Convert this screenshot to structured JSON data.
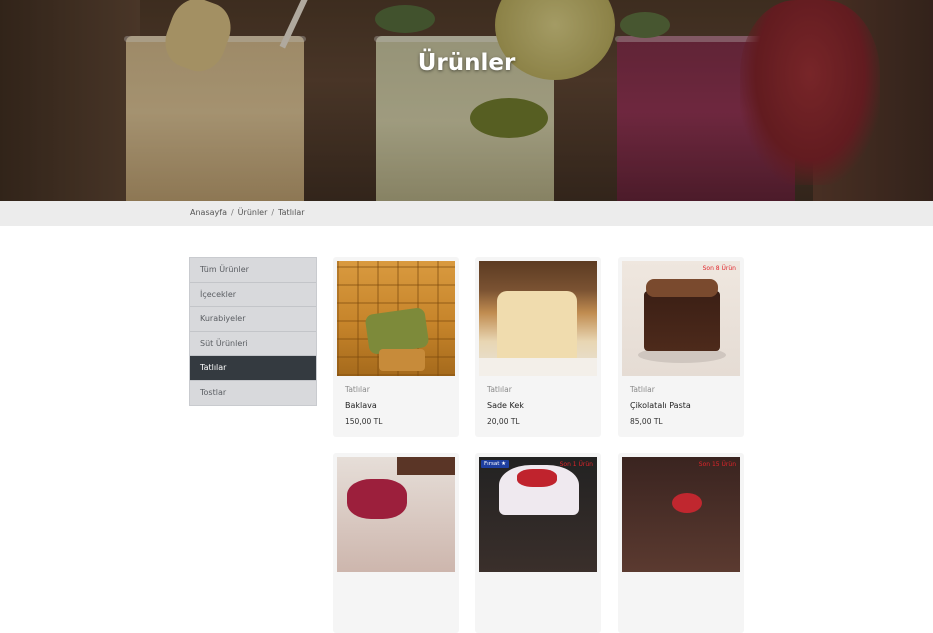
{
  "hero": {
    "title": "Ürünler"
  },
  "breadcrumb": {
    "items": [
      "Anasayfa",
      "Ürünler",
      "Tatlılar"
    ],
    "separator": "/"
  },
  "sidebar": {
    "items": [
      {
        "label": "Tüm Ürünler",
        "active": false
      },
      {
        "label": "İçecekler",
        "active": false
      },
      {
        "label": "Kurabiyeler",
        "active": false
      },
      {
        "label": "Süt Ürünleri",
        "active": false
      },
      {
        "label": "Tatlılar",
        "active": true
      },
      {
        "label": "Tostlar",
        "active": false
      }
    ]
  },
  "products": [
    {
      "category": "Tatlılar",
      "name": "Baklava",
      "price": "150,00 TL",
      "image": "baklava-image"
    },
    {
      "category": "Tatlılar",
      "name": "Sade Kek",
      "price": "20,00 TL",
      "image": "cake-image"
    },
    {
      "category": "Tatlılar",
      "name": "Çikolatalı Pasta",
      "price": "85,00 TL",
      "image": "chocolate-cake-image",
      "badge": "Son 8 Ürün"
    },
    {
      "image": "berry-dessert-image"
    },
    {
      "image": "fruit-cake-image",
      "badge": "Son 1 Ürün",
      "promo": "Fırsat ★"
    },
    {
      "image": "chocolate-dessert-image",
      "badge": "Son 15 Ürün"
    }
  ],
  "colors": {
    "active_sidebar": "#343a40",
    "sidebar_bg": "#d8d9dc",
    "badge_red": "#e0242a",
    "promo_blue": "#1e3fa0"
  }
}
